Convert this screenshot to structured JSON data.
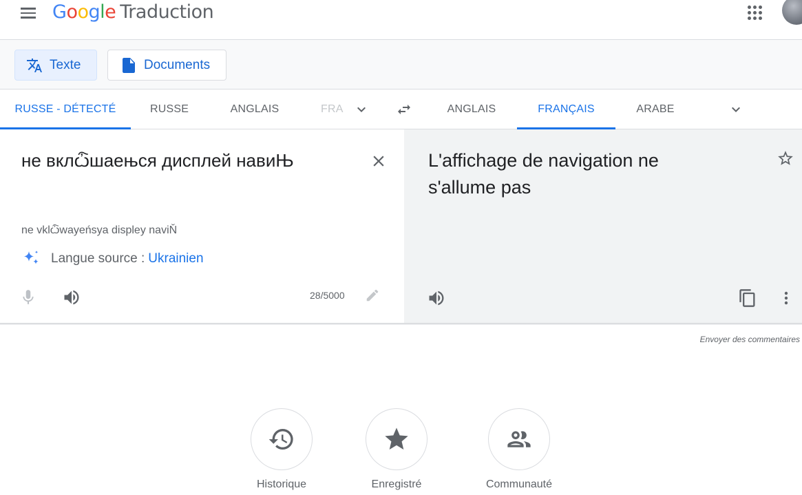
{
  "header": {
    "logo_letters": [
      "G",
      "o",
      "o",
      "g",
      "l",
      "e"
    ],
    "product": "Traduction"
  },
  "modes": {
    "text_label": "Texte",
    "docs_label": "Documents"
  },
  "source_langs": {
    "detected": "RUSSE - DÉTECTÉ",
    "lang1": "RUSSE",
    "lang2": "ANGLAIS",
    "lang3": "FRA"
  },
  "target_langs": {
    "lang1": "ANGLAIS",
    "lang2": "FRANÇAIS",
    "lang3": "ARABE"
  },
  "source": {
    "text": "не вклѽшаењся дисплей навиЊ",
    "transliteration": "ne vklѽwayeńsya displey naviŇ",
    "detect_prefix": "Langue source :",
    "detect_link": "Ukrainien",
    "char_count": "28/5000"
  },
  "target": {
    "text": "L'affichage de navigation ne s'allume pas"
  },
  "feedback": "Envoyer des commentaires",
  "bottom": {
    "history": "Historique",
    "saved": "Enregistré",
    "community": "Communauté"
  },
  "colors": {
    "accent": "#1a73e8",
    "active_mode_bg": "#e8f0fe",
    "target_panel_bg": "#f1f3f4"
  },
  "icons": [
    "menu-icon",
    "apps-icon",
    "translate-icon",
    "document-icon",
    "chevron-down-icon",
    "swap-icon",
    "close-icon",
    "sparkle-icon",
    "mic-icon",
    "speaker-icon",
    "pencil-icon",
    "star-icon",
    "copy-icon",
    "more-vert-icon",
    "history-icon",
    "star-icon",
    "people-icon"
  ]
}
